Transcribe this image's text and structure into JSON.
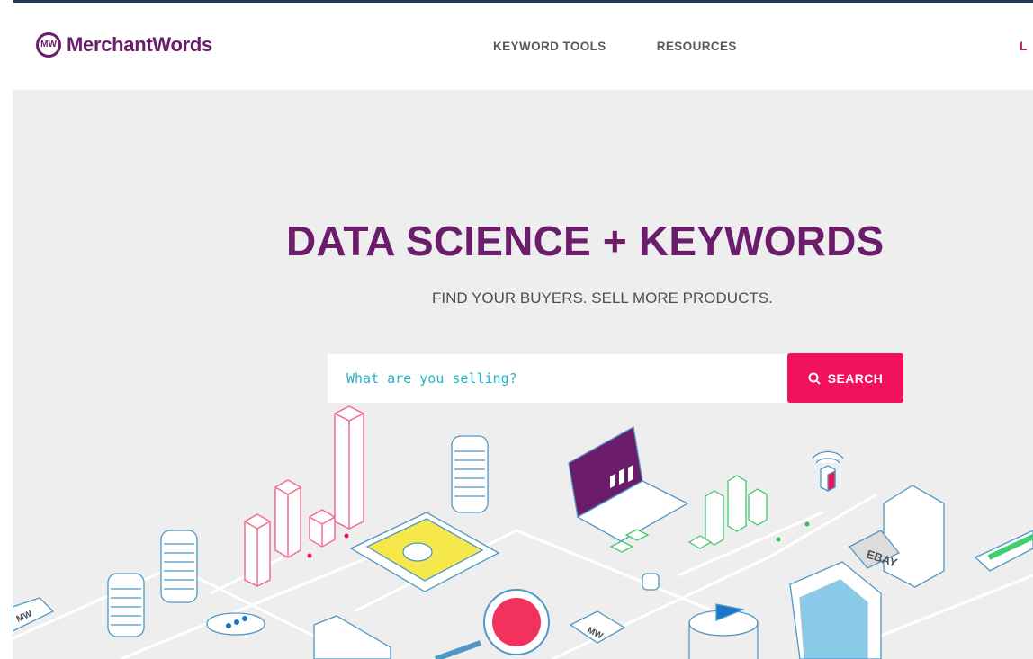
{
  "header": {
    "logo_name": "MerchantWords",
    "logo_mark": "MW",
    "nav": [
      "KEYWORD TOOLS",
      "RESOURCES"
    ],
    "login_partial": "L"
  },
  "hero": {
    "headline": "DATA SCIENCE + KEYWORDS",
    "subhead": "FIND YOUR BUYERS. SELL MORE PRODUCTS.",
    "search_placeholder": "What are you selling?",
    "search_button": "SEARCH",
    "illustration_labels": {
      "ebay": "EBAY",
      "mw_left": "MW",
      "mw_center": "MW"
    }
  },
  "colors": {
    "brand_purple": "#6b1d6b",
    "accent_pink": "#f2125b",
    "input_placeholder": "#23b3c7",
    "hero_bg": "#eeeeef"
  }
}
